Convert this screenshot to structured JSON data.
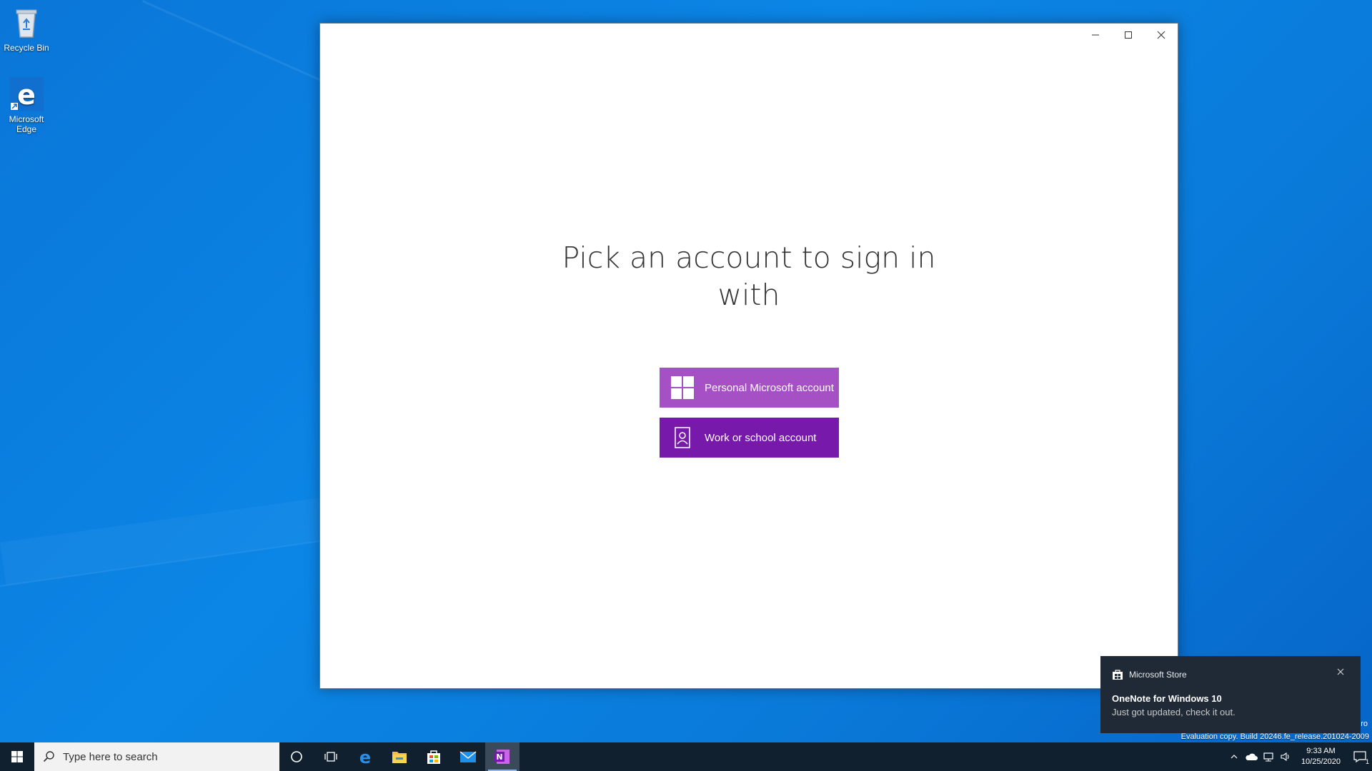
{
  "desktop": {
    "icons": [
      {
        "label": "Recycle Bin",
        "icon": "recycle-bin-icon"
      },
      {
        "label_line1": "Microsoft",
        "label_line2": "Edge",
        "icon": "edge-icon"
      }
    ]
  },
  "window": {
    "controls": [
      "minimize-icon",
      "maximize-icon",
      "close-icon"
    ],
    "title_line1": "Pick an account to sign in",
    "title_line2": "with",
    "buttons": {
      "personal": "Personal Microsoft account",
      "work": "Work or school account"
    },
    "colors": {
      "personal": "#a650c6",
      "work": "#7719aa"
    }
  },
  "toast": {
    "app": "Microsoft Store",
    "title": "OneNote for Windows 10",
    "body": "Just got updated, check it out."
  },
  "watermark": {
    "eval_text": "Evaluation copy. Build 20246.fe_release.201024-2009",
    "eval_edge": "ro"
  },
  "taskbar": {
    "search_placeholder": "Type here to search",
    "apps": [
      "cortana-icon",
      "task-view-icon",
      "edge-icon",
      "file-explorer-icon",
      "store-icon",
      "mail-icon",
      "onenote-icon"
    ],
    "clock_time": "9:33 AM",
    "clock_date": "10/25/2020",
    "notification_count": "1"
  }
}
